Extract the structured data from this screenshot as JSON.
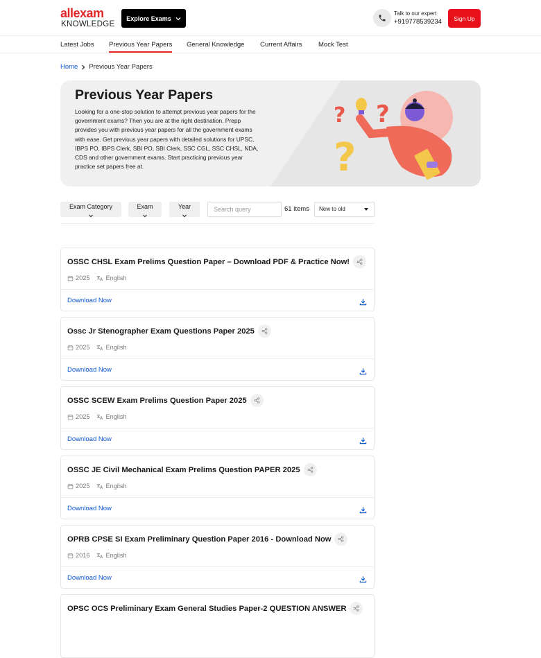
{
  "header": {
    "logo_top": "allexam",
    "logo_bottom": "KNOWLEDGE",
    "explore_label": "Explore Exams",
    "expert_label": "Talk to our expert",
    "expert_phone": "+919778539234",
    "signup_label": "Sign Up"
  },
  "nav": {
    "items": [
      "Latest Jobs",
      "Previous Year Papers",
      "General Knowledge",
      "Current Affairs",
      "Mock Test"
    ],
    "active": "Previous Year Papers"
  },
  "breadcrumb": {
    "home": "Home",
    "current": "Previous Year Papers"
  },
  "hero": {
    "title": "Previous Year Papers",
    "description": "Looking for a one-stop solution to attempt previous year papers for the government exams? Then you are at the right destination. Prepp provides you with previous year papers for all the government exams with ease. Get previous year papers with detailed solutions for UPSC, IBPS PO, IBPS Clerk, SBI PO, SBI Clerk, SSC CGL, SSC CHSL, NDA, CDS and other government exams. Start practicing previous year practice set papers free at."
  },
  "filters": {
    "exam_category": "Exam Category",
    "exam": "Exam",
    "year": "Year",
    "search_placeholder": "Search query",
    "count": "61 items",
    "sort": "New to old"
  },
  "papers": [
    {
      "title": "OSSC CHSL Exam Prelims Question Paper – Download PDF & Practice Now!",
      "year": "2025",
      "language": "English",
      "action": "Download Now"
    },
    {
      "title": "Ossc Jr Stenographer Exam Questions Paper 2025",
      "year": "2025",
      "language": "English",
      "action": "Download Now"
    },
    {
      "title": "OSSC SCEW Exam Prelims Question Paper 2025",
      "year": "2025",
      "language": "English",
      "action": "Download Now"
    },
    {
      "title": "OSSC JE Civil Mechanical Exam Prelims Question PAPER 2025",
      "year": "2025",
      "language": "English",
      "action": "Download Now"
    },
    {
      "title": "OPRB CPSE SI Exam Preliminary Question Paper 2016 - Download Now",
      "year": "2016",
      "language": "English",
      "action": "Download Now"
    },
    {
      "title": "OPSC OCS Preliminary Exam General Studies Paper-2 QUESTION ANSWER",
      "year": "",
      "language": "",
      "action": ""
    }
  ],
  "colors": {
    "brand_red": "#e3262a",
    "link_blue": "#0b57d0",
    "hero_bg": "#f0f0f0"
  },
  "icons": [
    "phone-icon",
    "chevron-down-icon",
    "calendar-icon",
    "translate-icon",
    "share-icon",
    "download-icon"
  ]
}
